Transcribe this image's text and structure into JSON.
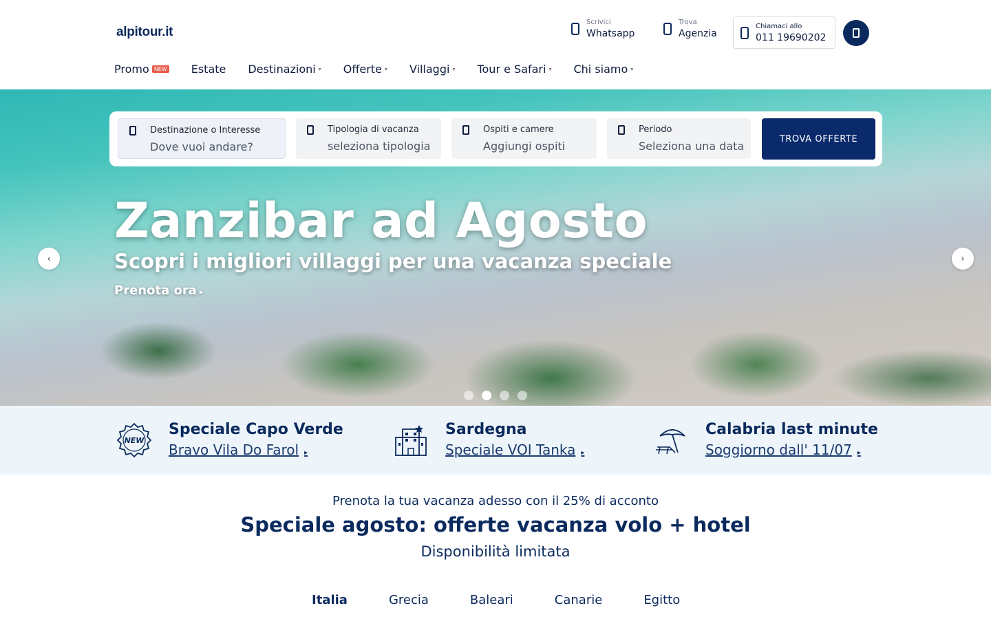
{
  "header": {
    "logo": "alpitour.it",
    "whatsapp": {
      "small": "Scrivici",
      "big": "Whatsapp",
      "icon": "whatsapp-icon"
    },
    "agenzia": {
      "small": "Trova",
      "big": "Agenzia",
      "icon": "location-icon"
    },
    "phone": {
      "small": "Chiamaci allo",
      "big": "011 19690202",
      "icon": "phone-icon"
    },
    "user_icon": "user-icon"
  },
  "nav": {
    "items": [
      {
        "label": "Promo",
        "badge": "NEW"
      },
      {
        "label": "Estate"
      },
      {
        "label": "Destinazioni",
        "chevron": "▾"
      },
      {
        "label": "Offerte",
        "chevron": "▾"
      },
      {
        "label": "Villaggi",
        "chevron": "▾"
      },
      {
        "label": "Tour e Safari",
        "chevron": "▾"
      },
      {
        "label": "Chi siamo",
        "chevron": "▾"
      }
    ]
  },
  "search": {
    "destination": {
      "label": "Destinazione o Interesse",
      "placeholder": "Dove vuoi andare?"
    },
    "type": {
      "label": "Tipologia di vacanza",
      "value": "seleziona tipologia"
    },
    "guests": {
      "label": "Ospiti e camere",
      "value": "Aggiungi ospiti"
    },
    "period": {
      "label": "Periodo",
      "value": "Seleziona una data"
    },
    "button": "TROVA OFFERTE"
  },
  "hero": {
    "title": "Zanzibar ad Agosto",
    "subtitle": "Scopri i migliori villaggi per una vacanza speciale",
    "cta": "Prenota ora",
    "prev": "‹",
    "next": "›"
  },
  "promos": [
    {
      "title": "Speciale Capo Verde",
      "link": "Bravo Vila Do Farol"
    },
    {
      "title": "Sardegna",
      "link": "Speciale VOI Tanka"
    },
    {
      "title": "Calabria last minute",
      "link": "Soggiorno dall' 11/07"
    }
  ],
  "offers": {
    "pre": "Prenota la tua vacanza adesso con il 25% di acconto",
    "title": "Speciale agosto: offerte vacanza volo + hotel",
    "subtitle": "Disponibilità limitata",
    "tabs": [
      "Italia",
      "Grecia",
      "Baleari",
      "Canarie",
      "Egitto"
    ]
  },
  "colors": {
    "brand": "#0a2a5e",
    "button": "#0a2a6b",
    "badge": "#e85c4a",
    "strip": "#eef5fa"
  }
}
